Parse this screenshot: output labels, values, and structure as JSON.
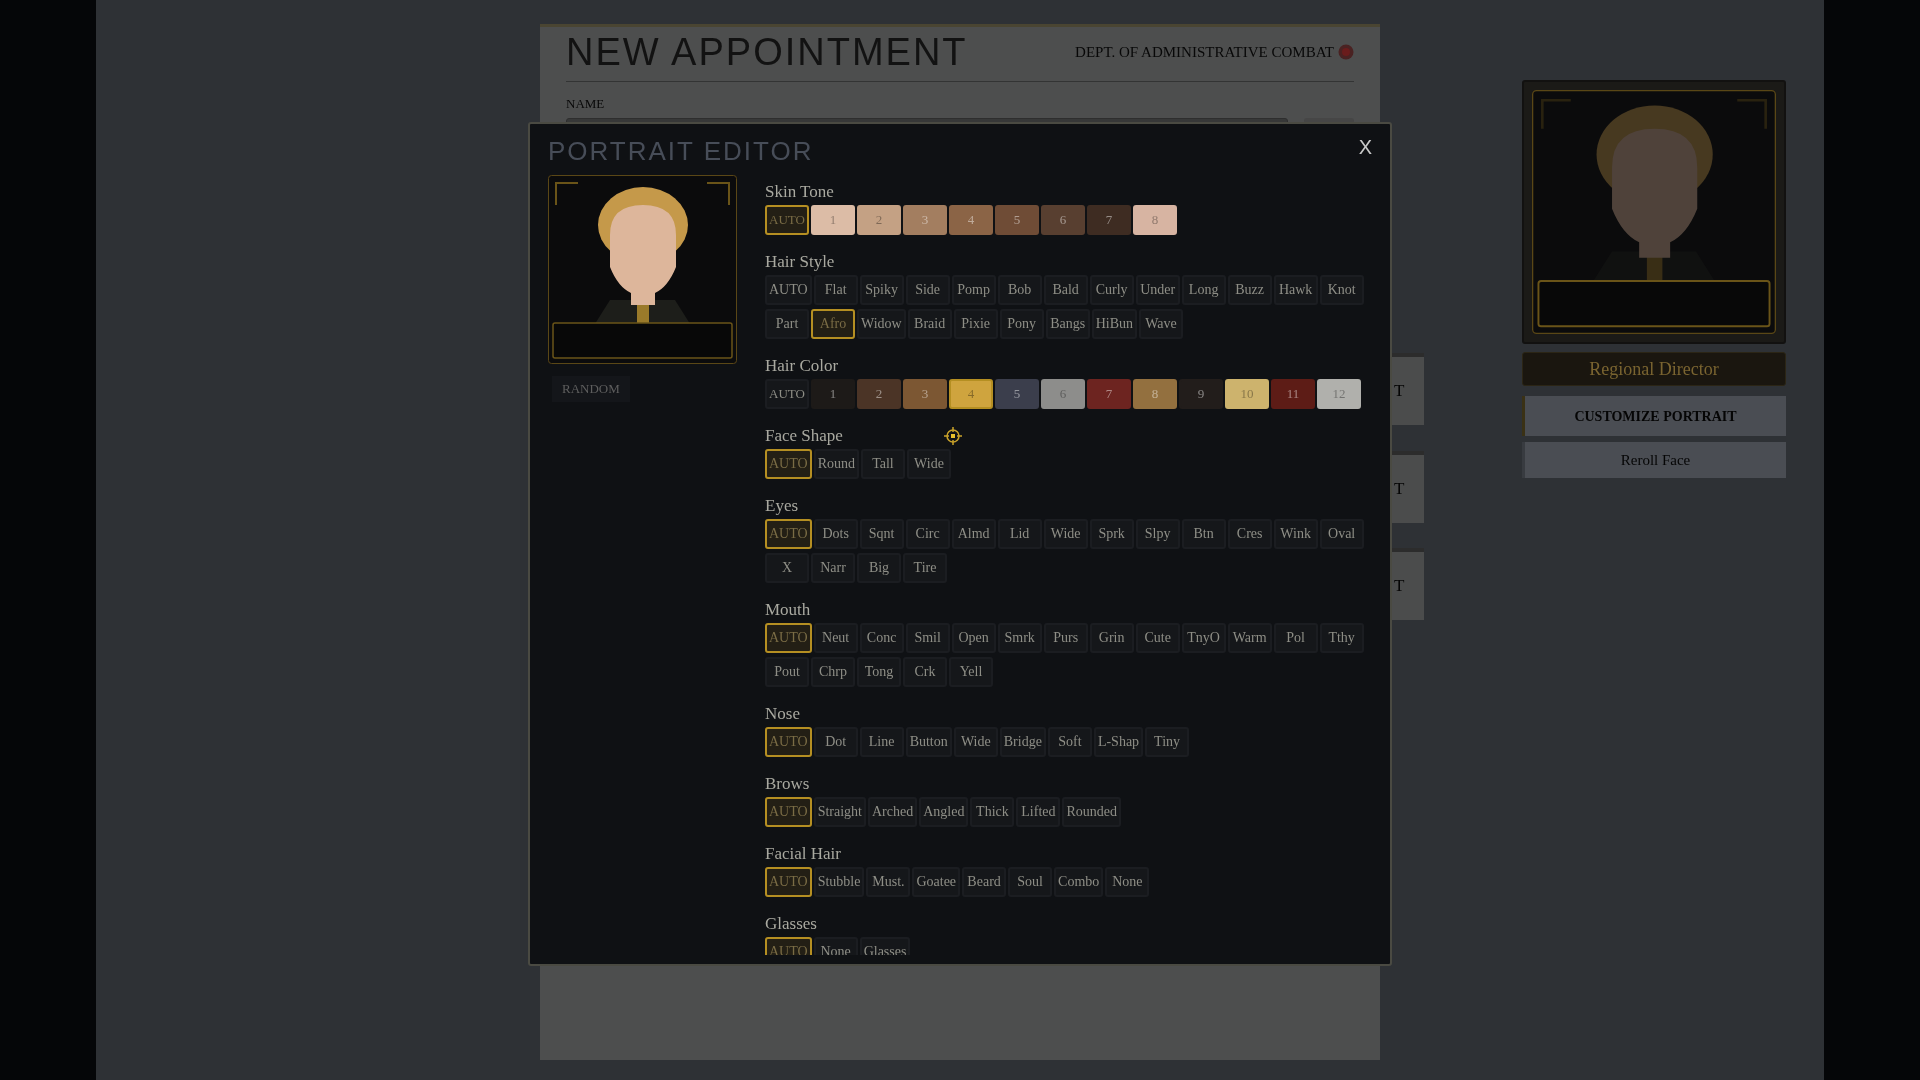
{
  "background_form": {
    "title": "NEW APPOINTMENT",
    "department": "DEPT. OF ADMINISTRATIVE COMBAT",
    "name_label": "NAME",
    "side_tabs": [
      "T",
      "T",
      "T"
    ]
  },
  "profile_card": {
    "role": "Regional Director",
    "buttons": [
      "CUSTOMIZE PORTRAIT",
      "Reroll Face"
    ]
  },
  "portrait_editor": {
    "title": "PORTRAIT EDITOR",
    "close": "X",
    "random_button": "RANDOM",
    "sections": [
      {
        "label": "Skin Tone",
        "kind": "swatch",
        "options": [
          {
            "label": "AUTO",
            "selected": true
          },
          {
            "label": "1",
            "color": "#dcbca6",
            "selected": false
          },
          {
            "label": "2",
            "color": "#c4a184",
            "selected": false
          },
          {
            "label": "3",
            "color": "#a37e60",
            "selected": false
          },
          {
            "label": "4",
            "color": "#8b6446",
            "selected": false
          },
          {
            "label": "5",
            "color": "#6f4c36",
            "selected": false
          },
          {
            "label": "6",
            "color": "#583f30",
            "selected": false
          },
          {
            "label": "7",
            "color": "#3e2c22",
            "selected": false
          },
          {
            "label": "8",
            "color": "#d7b4a2",
            "selected": false
          }
        ]
      },
      {
        "label": "Hair Style",
        "kind": "text",
        "options": [
          {
            "label": "AUTO",
            "selected": false
          },
          {
            "label": "Flat",
            "selected": false
          },
          {
            "label": "Spiky",
            "selected": false
          },
          {
            "label": "Side",
            "selected": false
          },
          {
            "label": "Pomp",
            "selected": false
          },
          {
            "label": "Bob",
            "selected": false
          },
          {
            "label": "Bald",
            "selected": false
          },
          {
            "label": "Curly",
            "selected": false
          },
          {
            "label": "Under",
            "selected": false
          },
          {
            "label": "Long",
            "selected": false
          },
          {
            "label": "Buzz",
            "selected": false
          },
          {
            "label": "Hawk",
            "selected": false
          },
          {
            "label": "Knot",
            "selected": false
          },
          {
            "label": "Part",
            "selected": false
          },
          {
            "label": "Afro",
            "selected": true
          },
          {
            "label": "Widow",
            "selected": false
          },
          {
            "label": "Braid",
            "selected": false
          },
          {
            "label": "Pixie",
            "selected": false
          },
          {
            "label": "Pony",
            "selected": false
          },
          {
            "label": "Bangs",
            "selected": false
          },
          {
            "label": "HiBun",
            "selected": false
          },
          {
            "label": "Wave",
            "selected": false
          }
        ]
      },
      {
        "label": "Hair Color",
        "kind": "swatch",
        "options": [
          {
            "label": "AUTO",
            "selected": false
          },
          {
            "label": "1",
            "color": "#1d1a18",
            "selected": false
          },
          {
            "label": "2",
            "color": "#4b3426",
            "selected": false
          },
          {
            "label": "3",
            "color": "#7c5733",
            "selected": false
          },
          {
            "label": "4",
            "color": "#cfa43e",
            "selected": true
          },
          {
            "label": "5",
            "color": "#3b3e4c",
            "selected": false
          },
          {
            "label": "6",
            "color": "#8d8d8b",
            "selected": false
          },
          {
            "label": "7",
            "color": "#6d2420",
            "selected": false
          },
          {
            "label": "8",
            "color": "#93703f",
            "selected": false
          },
          {
            "label": "9",
            "color": "#221d1b",
            "selected": false
          },
          {
            "label": "10",
            "color": "#cdb36d",
            "selected": false
          },
          {
            "label": "11",
            "color": "#5d1c16",
            "selected": false
          },
          {
            "label": "12",
            "color": "#b0b0ac",
            "selected": false
          }
        ]
      },
      {
        "label": "Face Shape",
        "kind": "text",
        "options": [
          {
            "label": "AUTO",
            "selected": true
          },
          {
            "label": "Round",
            "selected": false
          },
          {
            "label": "Tall",
            "selected": false
          },
          {
            "label": "Wide",
            "selected": false
          }
        ]
      },
      {
        "label": "Eyes",
        "kind": "text",
        "options": [
          {
            "label": "AUTO",
            "selected": true
          },
          {
            "label": "Dots",
            "selected": false
          },
          {
            "label": "Sqnt",
            "selected": false
          },
          {
            "label": "Circ",
            "selected": false
          },
          {
            "label": "Almd",
            "selected": false
          },
          {
            "label": "Lid",
            "selected": false
          },
          {
            "label": "Wide",
            "selected": false
          },
          {
            "label": "Sprk",
            "selected": false
          },
          {
            "label": "Slpy",
            "selected": false
          },
          {
            "label": "Btn",
            "selected": false
          },
          {
            "label": "Cres",
            "selected": false
          },
          {
            "label": "Wink",
            "selected": false
          },
          {
            "label": "Oval",
            "selected": false
          },
          {
            "label": "X",
            "selected": false
          },
          {
            "label": "Narr",
            "selected": false
          },
          {
            "label": "Big",
            "selected": false
          },
          {
            "label": "Tire",
            "selected": false
          }
        ]
      },
      {
        "label": "Mouth",
        "kind": "text",
        "options": [
          {
            "label": "AUTO",
            "selected": true
          },
          {
            "label": "Neut",
            "selected": false
          },
          {
            "label": "Conc",
            "selected": false
          },
          {
            "label": "Smil",
            "selected": false
          },
          {
            "label": "Open",
            "selected": false
          },
          {
            "label": "Smrk",
            "selected": false
          },
          {
            "label": "Purs",
            "selected": false
          },
          {
            "label": "Grin",
            "selected": false
          },
          {
            "label": "Cute",
            "selected": false
          },
          {
            "label": "TnyO",
            "selected": false
          },
          {
            "label": "Warm",
            "selected": false
          },
          {
            "label": "Pol",
            "selected": false
          },
          {
            "label": "Tthy",
            "selected": false
          },
          {
            "label": "Pout",
            "selected": false
          },
          {
            "label": "Chrp",
            "selected": false
          },
          {
            "label": "Tong",
            "selected": false
          },
          {
            "label": "Crk",
            "selected": false
          },
          {
            "label": "Yell",
            "selected": false
          }
        ]
      },
      {
        "label": "Nose",
        "kind": "text",
        "options": [
          {
            "label": "AUTO",
            "selected": true
          },
          {
            "label": "Dot",
            "selected": false
          },
          {
            "label": "Line",
            "selected": false
          },
          {
            "label": "Button",
            "selected": false
          },
          {
            "label": "Wide",
            "selected": false
          },
          {
            "label": "Bridge",
            "selected": false
          },
          {
            "label": "Soft",
            "selected": false
          },
          {
            "label": "L-Shap",
            "selected": false
          },
          {
            "label": "Tiny",
            "selected": false
          }
        ]
      },
      {
        "label": "Brows",
        "kind": "text",
        "options": [
          {
            "label": "AUTO",
            "selected": true
          },
          {
            "label": "Straight",
            "selected": false
          },
          {
            "label": "Arched",
            "selected": false
          },
          {
            "label": "Angled",
            "selected": false
          },
          {
            "label": "Thick",
            "selected": false
          },
          {
            "label": "Lifted",
            "selected": false
          },
          {
            "label": "Rounded",
            "selected": false
          }
        ]
      },
      {
        "label": "Facial Hair",
        "kind": "text",
        "options": [
          {
            "label": "AUTO",
            "selected": true
          },
          {
            "label": "Stubble",
            "selected": false
          },
          {
            "label": "Must.",
            "selected": false
          },
          {
            "label": "Goatee",
            "selected": false
          },
          {
            "label": "Beard",
            "selected": false
          },
          {
            "label": "Soul",
            "selected": false
          },
          {
            "label": "Combo",
            "selected": false
          },
          {
            "label": "None",
            "selected": false
          }
        ]
      },
      {
        "label": "Glasses",
        "kind": "text",
        "options": [
          {
            "label": "AUTO",
            "selected": true
          },
          {
            "label": "None",
            "selected": false
          },
          {
            "label": "Glasses",
            "selected": false
          }
        ]
      }
    ]
  }
}
